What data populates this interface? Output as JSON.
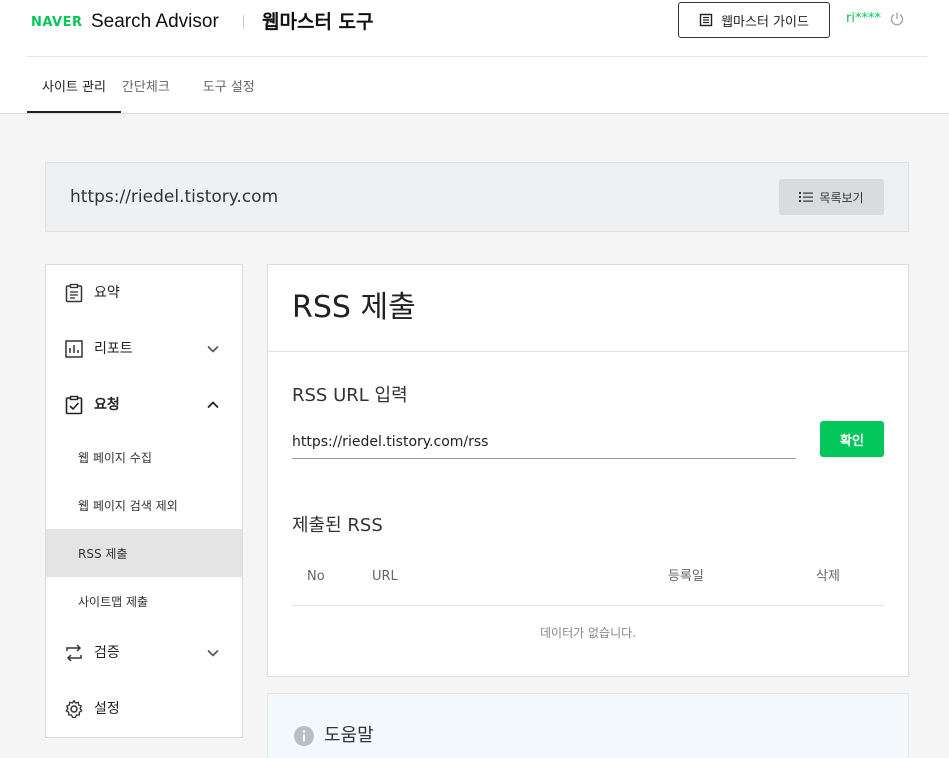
{
  "header": {
    "naver_logo": "NAVER",
    "app_name": "Search Advisor",
    "tool_title": "웹마스터 도구",
    "guide_button": "웹마스터 가이드",
    "user_id": "ri****"
  },
  "tabs": [
    {
      "label": "사이트 관리",
      "active": true
    },
    {
      "label": "간단체크",
      "active": false
    },
    {
      "label": "도구 설정",
      "active": false
    }
  ],
  "site": {
    "url": "https://riedel.tistory.com",
    "list_button": "목록보기"
  },
  "sidebar": {
    "items": [
      {
        "label": "요약",
        "icon": "clipboard-icon"
      },
      {
        "label": "리포트",
        "icon": "bar-chart-icon"
      },
      {
        "label": "요청",
        "icon": "clipboard-check-icon"
      },
      {
        "label": "검증",
        "icon": "repeat-icon"
      },
      {
        "label": "설정",
        "icon": "gear-icon"
      }
    ],
    "sub_items": [
      {
        "label": "웹 페이지 수집"
      },
      {
        "label": "웹 페이지 검색 제외"
      },
      {
        "label": "RSS 제출",
        "active": true
      },
      {
        "label": "사이트맵 제출"
      }
    ]
  },
  "main": {
    "title": "RSS 제출",
    "input_section": "RSS URL 입력",
    "input_value": "https://riedel.tistory.com/rss",
    "confirm_button": "확인",
    "submitted_section": "제출된 RSS",
    "columns": [
      "No",
      "URL",
      "등록일",
      "삭제"
    ],
    "empty_message": "데이터가 없습니다."
  },
  "help": {
    "title": "도움말"
  },
  "colors": {
    "brand_green": "#03c75a",
    "active_bg": "#e4e4e4"
  }
}
